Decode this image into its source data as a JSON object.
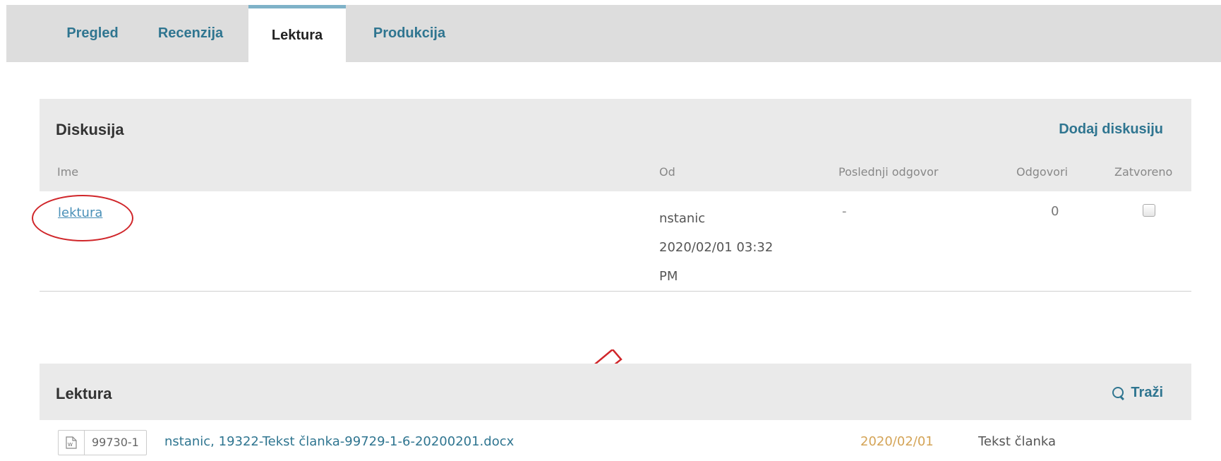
{
  "tabs": [
    {
      "label": "Pregled"
    },
    {
      "label": "Recenzija"
    },
    {
      "label": "Lektura"
    },
    {
      "label": "Produkcija"
    }
  ],
  "active_tab": "Lektura",
  "discussion": {
    "title": "Diskusija",
    "action": "Dodaj diskusiju",
    "columns": {
      "name": "Ime",
      "from": "Od",
      "last_reply": "Poslednji odgovor",
      "replies": "Odgovori",
      "closed": "Zatvoreno"
    },
    "rows": [
      {
        "name": "lektura",
        "from_user": "nstanic",
        "from_date": "2020/02/01 03:32",
        "from_time_suffix": "PM",
        "last_reply": "-",
        "replies": "0",
        "closed": false
      }
    ]
  },
  "lektura": {
    "title": "Lektura",
    "search_label": "Traži",
    "files": [
      {
        "icon": "word-document-icon",
        "id": "99730-1",
        "name": "nstanic, 19322-Tekst članka-99729-1-6-20200201.docx",
        "date": "2020/02/01",
        "type": "Tekst članka"
      }
    ]
  },
  "colors": {
    "accent": "#2f7590",
    "link": "#4a90b8",
    "annotation": "#d0262a",
    "date": "#d4a457",
    "tabbar_bg": "#dddddd",
    "panel_bg": "#eaeaea"
  }
}
